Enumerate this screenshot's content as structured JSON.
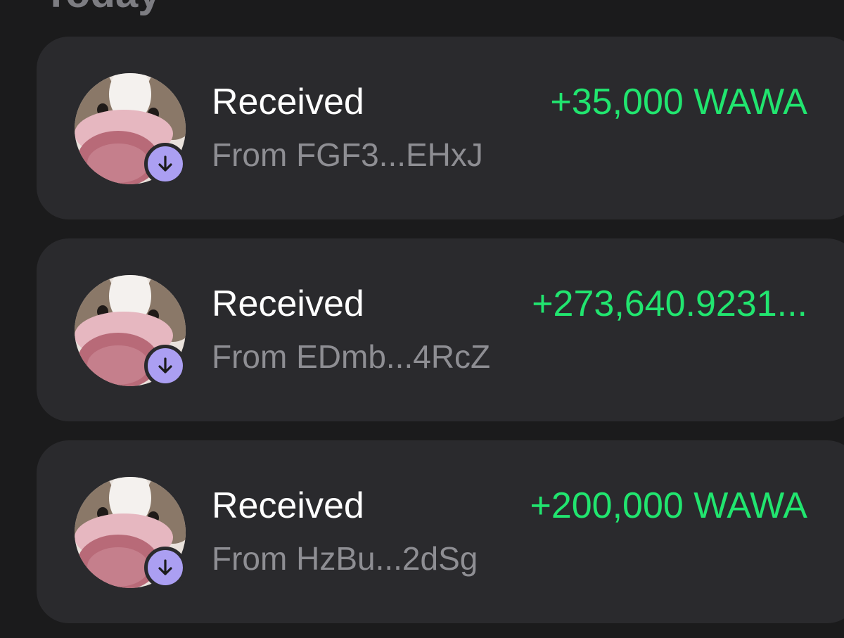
{
  "section": {
    "title": "Today"
  },
  "colors": {
    "background": "#1b1b1c",
    "card": "#2a2a2d",
    "positive_amount": "#21e56f",
    "secondary_text": "#8e8e93",
    "badge": "#ab9ff2"
  },
  "transactions": [
    {
      "title": "Received",
      "from": "From FGF3...EHxJ",
      "amount": "+35,000 WAWA",
      "icon": "arrow-down-icon"
    },
    {
      "title": "Received",
      "from": "From EDmb...4RcZ",
      "amount": "+273,640.9231...",
      "icon": "arrow-down-icon"
    },
    {
      "title": "Received",
      "from": "From HzBu...2dSg",
      "amount": "+200,000 WAWA",
      "icon": "arrow-down-icon"
    }
  ]
}
